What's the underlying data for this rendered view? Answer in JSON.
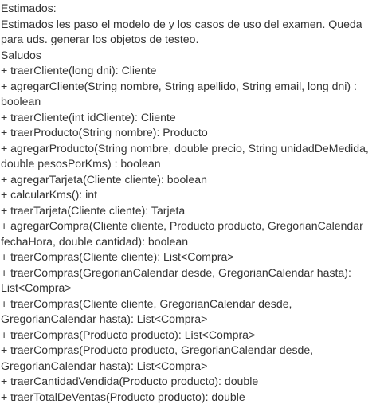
{
  "message": {
    "greeting": "Estimados:",
    "body_line1": "Estimados les paso el modelo de y los casos de uso del examen. Queda",
    "body_line2": "para uds. generar los objetos de testeo.",
    "signoff": "Saludos"
  },
  "methods": [
    "+ traerCliente(long dni): Cliente",
    "+ agregarCliente(String nombre, String apellido, String email, long dni) : boolean",
    "+ traerCliente(int idCliente): Cliente",
    "+ traerProducto(String nombre): Producto",
    "+ agregarProducto(String nombre, double precio, String unidadDeMedida, double pesosPorKms) : boolean",
    "+ agregarTarjeta(Cliente cliente): boolean",
    "+ calcularKms(): int",
    "+ traerTarjeta(Cliente cliente): Tarjeta",
    "+ agregarCompra(Cliente cliente, Producto producto, GregorianCalendar fechaHora, double cantidad): boolean",
    "+ traerCompras(Cliente cliente): List<Compra>",
    "+ traerCompras(GregorianCalendar desde, GregorianCalendar hasta): List<Compra>",
    "+ traerCompras(Cliente cliente, GregorianCalendar desde, GregorianCalendar hasta): List<Compra>",
    "+ traerCompras(Producto producto): List<Compra>",
    "+ traerCompras(Producto producto, GregorianCalendar desde, GregorianCalendar hasta): List<Compra>",
    "+ traerCantidadVendida(Producto producto): double",
    "+ traerTotalDeVentas(Producto producto): double"
  ]
}
